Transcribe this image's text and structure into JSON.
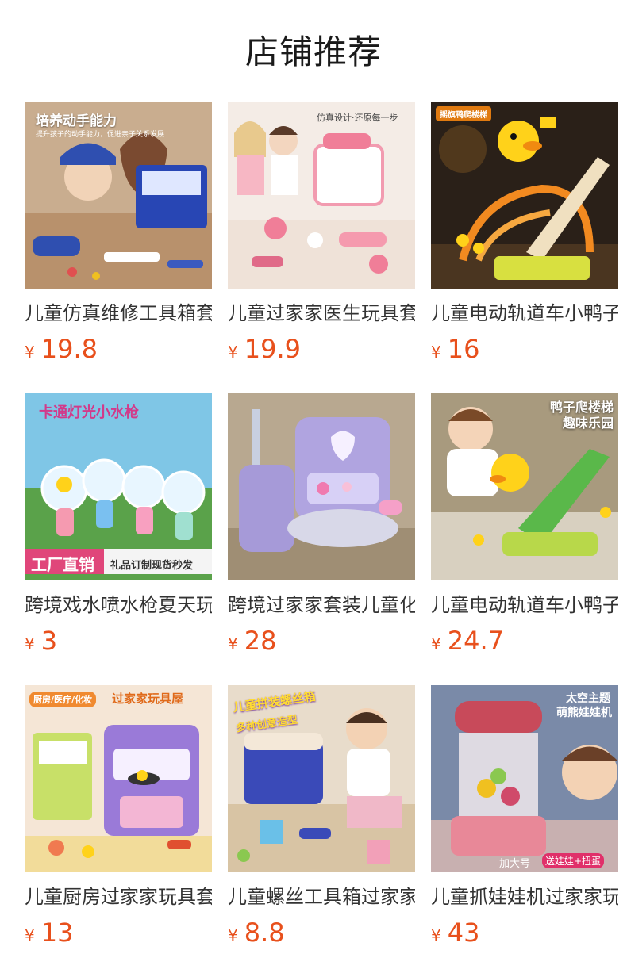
{
  "page": {
    "title": "店铺推荐"
  },
  "currency_symbol": "¥",
  "products": [
    {
      "name": "儿童仿真维修工具箱套装",
      "price": "19.8",
      "image_icon": "toolbox-kids-image",
      "overlay": [
        "培养动手能力",
        "提升孩子的动手能力，促进亲子关系发展"
      ]
    },
    {
      "name": "儿童过家家医生玩具套装",
      "price": "19.9",
      "image_icon": "doctor-kit-image",
      "overlay": [
        "仿真设计·还原每一步"
      ]
    },
    {
      "name": "儿童电动轨道车小鸭子爬楼梯",
      "price": "16",
      "image_icon": "duck-slide-image",
      "overlay": [
        "摇旗鸭爬楼梯"
      ]
    },
    {
      "name": "跨境戏水喷水枪夏天玩具",
      "price": "3",
      "image_icon": "water-gun-image",
      "overlay": [
        "卡通灯光小水枪",
        "工厂直销",
        "礼品订制现货秒发"
      ]
    },
    {
      "name": "跨境过家家套装儿童化妆",
      "price": "28",
      "image_icon": "makeup-suitcase-image",
      "overlay": []
    },
    {
      "name": "儿童电动轨道车小鸭子滑梯",
      "price": "24.7",
      "image_icon": "duck-track-image",
      "overlay": [
        "鸭子爬楼梯",
        "趣味乐园"
      ]
    },
    {
      "name": "儿童厨房过家家玩具套装",
      "price": "13",
      "image_icon": "kitchen-set-image",
      "overlay": [
        "厨房/医疗/化妆",
        "过家家玩具屋"
      ]
    },
    {
      "name": "儿童螺丝工具箱过家家玩具",
      "price": "8.8",
      "image_icon": "screw-toolbox-image",
      "overlay": [
        "儿童拼装螺丝箱",
        "多种创意造型"
      ]
    },
    {
      "name": "儿童抓娃娃机过家家玩具",
      "price": "43",
      "image_icon": "claw-machine-image",
      "overlay": [
        "太空主题",
        "萌熊娃娃机",
        "加大号",
        "送娃娃+扭蛋"
      ]
    }
  ],
  "colors": {
    "price": "#e8501c",
    "title": "#1a1a1a",
    "name": "#333333"
  }
}
